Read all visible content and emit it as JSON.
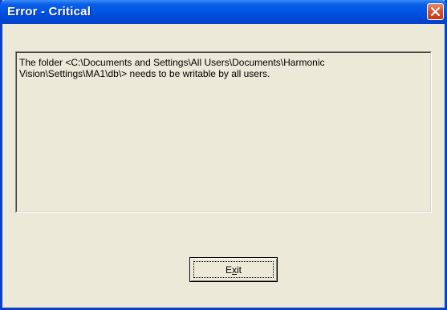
{
  "window": {
    "title": "Error - Critical",
    "close_icon": "close-icon"
  },
  "message": {
    "text": "The folder <C:\\Documents and Settings\\All Users\\Documents\\Harmonic\nVision\\Settings\\MA1\\db\\> needs to be writable by all users."
  },
  "buttons": {
    "exit_pre": "E",
    "exit_mnemonic": "x",
    "exit_post": "it"
  },
  "colors": {
    "titlebar": "#0054e3",
    "dialog_bg": "#ece9d8",
    "close_button": "#d8542c"
  }
}
